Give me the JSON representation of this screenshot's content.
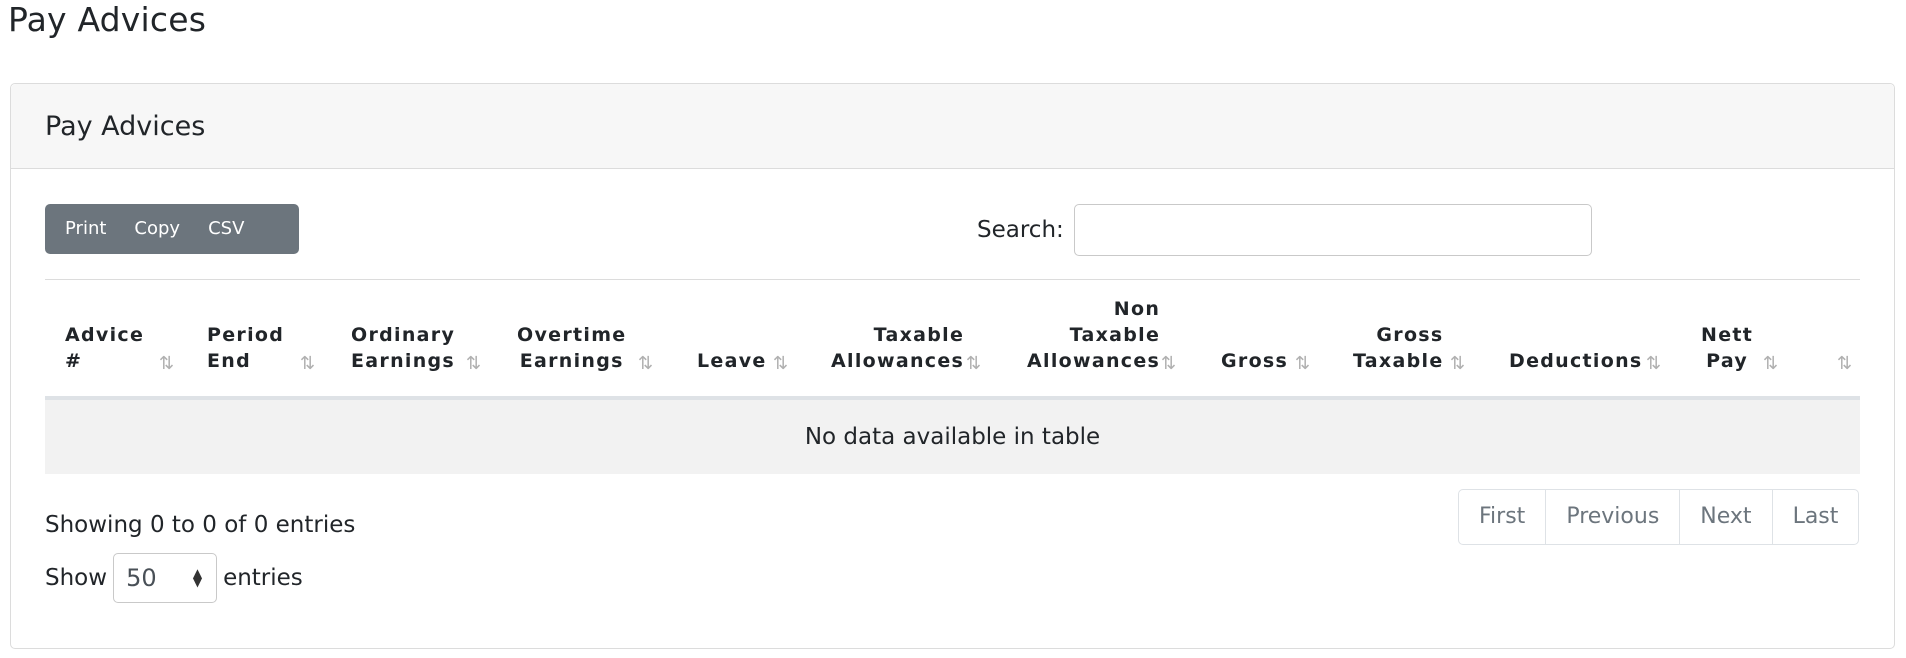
{
  "page": {
    "title": "Pay Advices"
  },
  "card": {
    "title": "Pay Advices"
  },
  "toolbar": {
    "print_label": "Print",
    "copy_label": "Copy",
    "csv_label": "CSV"
  },
  "search": {
    "label": "Search:",
    "value": "",
    "placeholder": ""
  },
  "table": {
    "columns": [
      {
        "line1": "Advice",
        "line2": "#"
      },
      {
        "line1": "Period",
        "line2": "End"
      },
      {
        "line1": "Ordinary",
        "line2": "Earnings"
      },
      {
        "line1": "Overtime",
        "line2": "Earnings"
      },
      {
        "line1": "Leave"
      },
      {
        "line1": "Taxable",
        "line2": "Allowances"
      },
      {
        "line0": "Non",
        "line1": "Taxable",
        "line2": "Allowances"
      },
      {
        "line1": "Gross"
      },
      {
        "line1": "Gross",
        "line2": "Taxable"
      },
      {
        "line1": "Deductions"
      },
      {
        "line1": "Nett",
        "line2": "Pay"
      }
    ],
    "sort_icon": "⇅",
    "empty_message": "No data available in table"
  },
  "info": {
    "text": "Showing 0 to 0 of 0 entries"
  },
  "length": {
    "show_label": "Show",
    "value": "50",
    "entries_label": "entries"
  },
  "pagination": {
    "first": "First",
    "previous": "Previous",
    "next": "Next",
    "last": "Last"
  },
  "icons": {
    "sort": "sort-arrows-icon",
    "select": "select-updown-icon"
  },
  "colors": {
    "button_group_bg": "#6c757d",
    "empty_row_bg": "#f2f2f2",
    "header_bg": "#f7f7f7"
  }
}
